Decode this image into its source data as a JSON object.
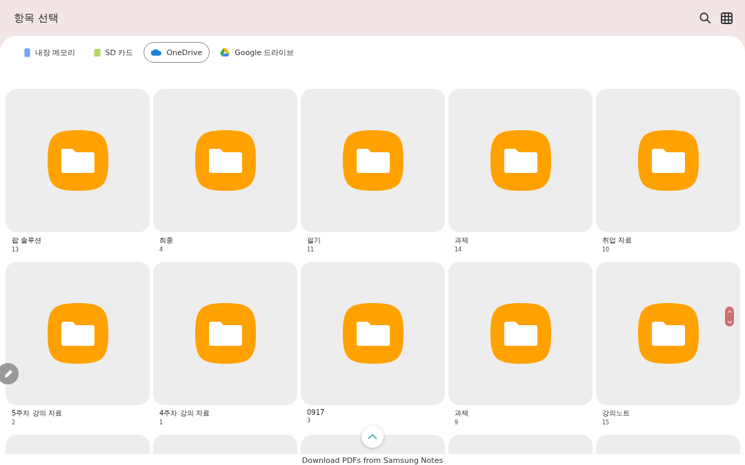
{
  "header": {
    "title": "항목 선택"
  },
  "tabs": [
    {
      "label": "내장 메모리",
      "kind": "phone",
      "selected": false
    },
    {
      "label": "SD 카드",
      "kind": "sd",
      "selected": false
    },
    {
      "label": "OneDrive",
      "kind": "cloud",
      "selected": true
    },
    {
      "label": "Google 드라이브",
      "kind": "drive",
      "selected": false
    }
  ],
  "folders": [
    {
      "name": "팝 솔루션",
      "count": "13"
    },
    {
      "name": "최종",
      "count": "4"
    },
    {
      "name": "필기",
      "count": "11"
    },
    {
      "name": "과제",
      "count": "14"
    },
    {
      "name": "취업 자료",
      "count": "10"
    },
    {
      "name": "5주차 강의 자료",
      "count": "2"
    },
    {
      "name": "4주차 강의 자료",
      "count": "1"
    },
    {
      "name": "0917",
      "count": "3"
    },
    {
      "name": "과제",
      "count": "9"
    },
    {
      "name": "강의노트",
      "count": "15"
    }
  ],
  "cut_row": [
    {
      "kind": "folder"
    },
    {
      "kind": "folder"
    },
    {
      "kind": "folder"
    },
    {
      "kind": "folder"
    },
    {
      "kind": "folder"
    }
  ],
  "caption": "Download PDFs from Samsung Notes"
}
